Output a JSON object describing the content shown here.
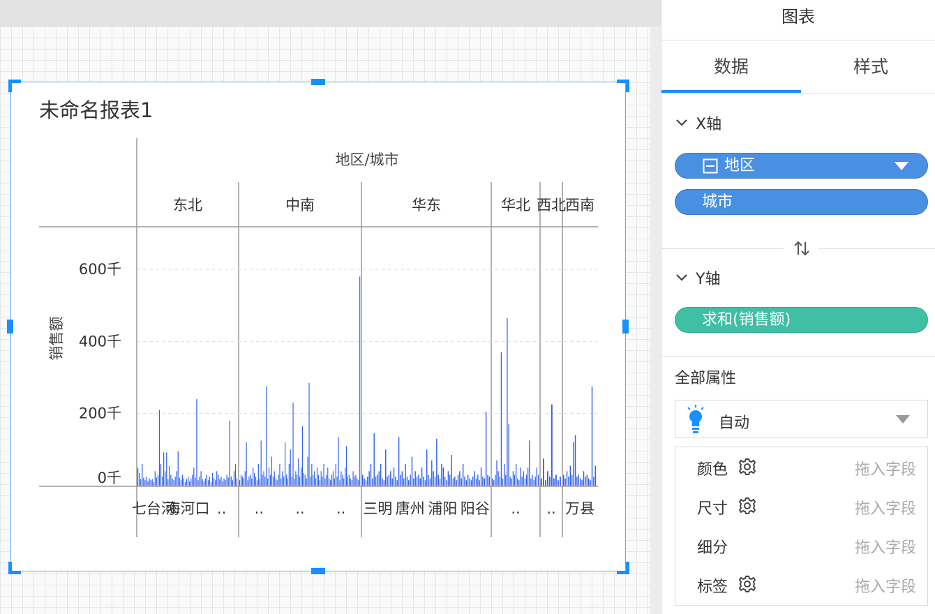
{
  "panel": {
    "title": "图表",
    "tabs": [
      {
        "label": "数据",
        "active": true
      },
      {
        "label": "样式",
        "active": false
      }
    ],
    "x_axis": {
      "label": "X轴",
      "fields": [
        {
          "label": "地区",
          "has_collapse_icon": true,
          "has_dropdown": true
        },
        {
          "label": "城市"
        }
      ]
    },
    "swap_icon": "swap-axes-icon",
    "y_axis": {
      "label": "Y轴",
      "fields": [
        {
          "label": "求和(销售额)"
        }
      ]
    },
    "all_properties": {
      "label": "全部属性",
      "mark_type": {
        "label": "自动",
        "icon": "lightbulb-icon"
      },
      "rows": [
        {
          "name": "颜色",
          "has_gear": true,
          "drop": "拖入字段"
        },
        {
          "name": "尺寸",
          "has_gear": true,
          "drop": "拖入字段"
        },
        {
          "name": "细分",
          "has_gear": false,
          "drop": "拖入字段"
        },
        {
          "name": "标签",
          "has_gear": true,
          "drop": "拖入字段"
        }
      ]
    }
  },
  "colors": {
    "accent": "#1890ff",
    "bar": "#2f5ff0",
    "pill_blue": "#4a90e2",
    "pill_teal": "#3fbfa4"
  },
  "chart_data": {
    "type": "bar",
    "title": "未命名报表1",
    "header": "地区/城市",
    "ylabel": "销售额",
    "y_ticks": [
      "0千",
      "200千",
      "400千",
      "600千"
    ],
    "y_tick_values": [
      0,
      200,
      400,
      600
    ],
    "ylim": [
      0,
      600
    ],
    "grid": true,
    "regions": [
      {
        "name": "东北",
        "city_labels": [
          "七台河",
          "海河口",
          ".."
        ]
      },
      {
        "name": "中南",
        "city_labels": [
          "..",
          "..",
          ".."
        ]
      },
      {
        "name": "华东",
        "city_labels": [
          "三明",
          "唐州",
          "浦阳",
          "阳谷"
        ]
      },
      {
        "name": "华北",
        "city_labels": [
          ".."
        ]
      },
      {
        "name": "西北",
        "city_labels": [
          ".."
        ]
      },
      {
        "name": "西南",
        "city_labels": [
          "万县"
        ]
      }
    ],
    "series": [
      {
        "values_by_region": [
          [
            48,
            35,
            18,
            60,
            22,
            15,
            25,
            12,
            20,
            15,
            18,
            10,
            40,
            22,
            30,
            210,
            60,
            25,
            92,
            40,
            92,
            18,
            55,
            30,
            20,
            15,
            25,
            40,
            95,
            22,
            15,
            30,
            20,
            10,
            18,
            25,
            12,
            20,
            30,
            50,
            22,
            240,
            15,
            25,
            40,
            18,
            12,
            20,
            30,
            15,
            25,
            10,
            35,
            20,
            15,
            40,
            30,
            18,
            25,
            12,
            20,
            15,
            30,
            22,
            180,
            25,
            15,
            40,
            60,
            20
          ],
          [
            15,
            30,
            25,
            20,
            40,
            120,
            15,
            25,
            30,
            20,
            50,
            35,
            25,
            15,
            60,
            20,
            125,
            30,
            40,
            25,
            275,
            20,
            50,
            30,
            80,
            25,
            40,
            20,
            15,
            30,
            60,
            20,
            40,
            25,
            120,
            30,
            20,
            60,
            100,
            25,
            230,
            20,
            40,
            30,
            75,
            25,
            50,
            165,
            35,
            30,
            20,
            80,
            285,
            25,
            60,
            30,
            40,
            20,
            50,
            30,
            15,
            40,
            25,
            60,
            20,
            30,
            50,
            20,
            15,
            30,
            40,
            20,
            60,
            25,
            135,
            15,
            40,
            30,
            20,
            50,
            110,
            25,
            30,
            20,
            15,
            40,
            25,
            30,
            20,
            15,
            580
          ],
          [
            30,
            20,
            15,
            25,
            40,
            60,
            20,
            145,
            25,
            30,
            40,
            60,
            20,
            15,
            100,
            25,
            30,
            40,
            20,
            50,
            25,
            15,
            135,
            30,
            40,
            20,
            60,
            25,
            15,
            30,
            80,
            20,
            40,
            25,
            30,
            20,
            50,
            25,
            15,
            100,
            30,
            20,
            70,
            40,
            25,
            130,
            30,
            20,
            60,
            50,
            25,
            15,
            40,
            30,
            85,
            20,
            25,
            15,
            30,
            40,
            20,
            60,
            25,
            15,
            30,
            20,
            15,
            25,
            40,
            20,
            30,
            15,
            50,
            25,
            20,
            205,
            30,
            25
          ],
          [
            20,
            15,
            30,
            70,
            40,
            25,
            370,
            20,
            60,
            30,
            465,
            170,
            25,
            20,
            40,
            30,
            60,
            20,
            15,
            50,
            25,
            40,
            20,
            30,
            50,
            125,
            20,
            30,
            15,
            25,
            50,
            30
          ],
          [
            20,
            75,
            15,
            40,
            25,
            225,
            20,
            30,
            15,
            25
          ],
          [
            30,
            20,
            40,
            25,
            55,
            30,
            120,
            140,
            25,
            30,
            20,
            15,
            40,
            25,
            30,
            20,
            15,
            275,
            25,
            55
          ]
        ]
      }
    ]
  }
}
